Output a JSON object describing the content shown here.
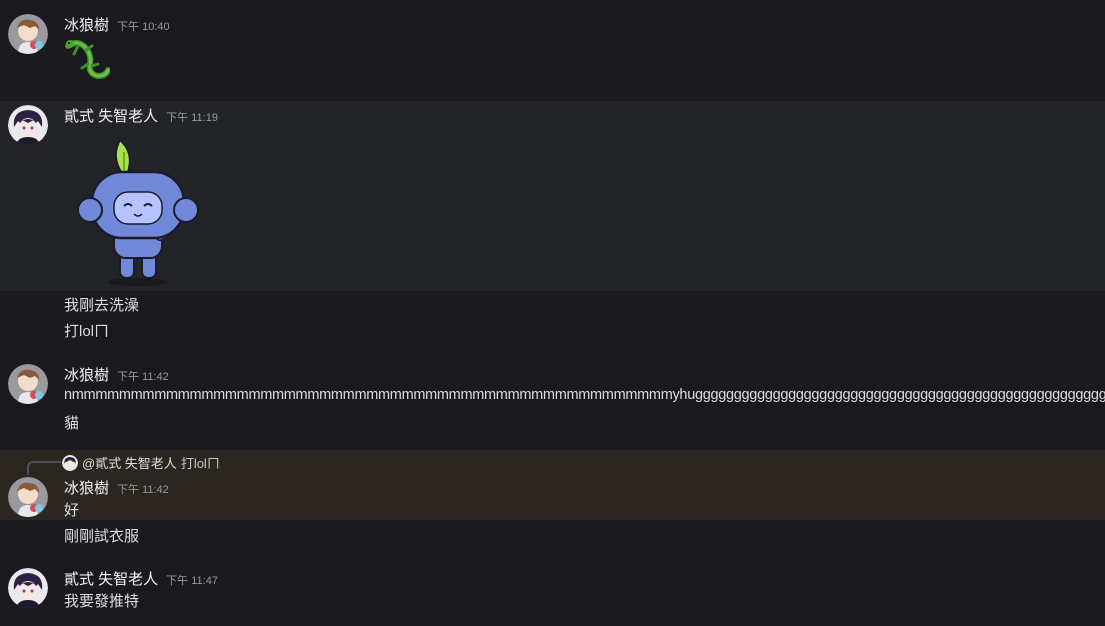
{
  "messages": [
    {
      "author": "冰狼樹",
      "time": "下午 10:40",
      "content_icon": "lizard-emoji"
    },
    {
      "author": "貳式 失智老人",
      "time": "下午 11:19",
      "content_icon": "wumpus-sticker",
      "lines": [
        "我剛去洗澡",
        "打lolㄇ"
      ]
    },
    {
      "author": "冰狼樹",
      "time": "下午 11:42",
      "lines": [
        "nmmmmmmmmmmmmmmmmmmmmmmmmmmmmmmmmmmmmmmmmmmmmmmmmmmmyhugggggggggggggggggggggggggggggggggggggggggggggggggggggggggg",
        "貓"
      ]
    },
    {
      "reply": {
        "mention": "@貳式 失智老人",
        "text": "打lolㄇ"
      },
      "author": "冰狼樹",
      "time": "下午 11:42",
      "lines": [
        "好",
        "剛剛試衣服"
      ]
    },
    {
      "author": "貳式 失智老人",
      "time": "下午 11:47",
      "lines": [
        "我要發推特"
      ]
    }
  ],
  "colors": {
    "background": "#1a1a1e",
    "hover": "#232428",
    "reply_highlight": "#2b2620",
    "wumpus": "#7289da",
    "leaf": "#a6e34a"
  }
}
